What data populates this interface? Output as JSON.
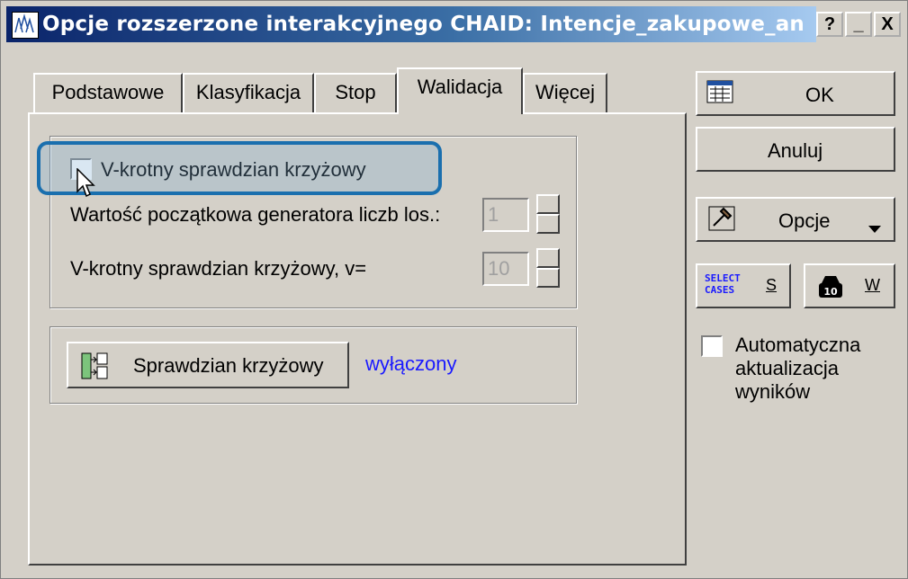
{
  "window": {
    "title": "Opcje rozszerzone interakcyjnego CHAID: Intencje_zakupowe_an",
    "help_label": "?",
    "minimize_label": "_",
    "close_label": "X"
  },
  "tabs": [
    {
      "label": "Podstawowe",
      "active": false
    },
    {
      "label": "Klasyfikacja",
      "active": false
    },
    {
      "label": "Stop",
      "active": false
    },
    {
      "label": "Walidacja",
      "active": true
    },
    {
      "label": "Więcej",
      "active": false
    }
  ],
  "validation": {
    "vfold_checkbox_label": "V-krotny sprawdzian krzyżowy",
    "vfold_checked": false,
    "seed_label": "Wartość początkowa generatora liczb los.:",
    "seed_value": "1",
    "v_label": "V-krotny sprawdzian krzyżowy, v=",
    "v_value": "10"
  },
  "crossval": {
    "button_label": "Sprawdzian krzyżowy",
    "status": "wyłączony",
    "status_color": "#1a1aff"
  },
  "side": {
    "ok_label": "OK",
    "cancel_label": "Anuluj",
    "options_label": "Opcje",
    "select_cases_line1": "SELECT",
    "select_cases_line2": "CASES",
    "select_cases_key": "S",
    "weight_key": "W",
    "auto_update_label_1": "Automatyczna",
    "auto_update_label_2": "aktualizacja",
    "auto_update_label_3": "wyników",
    "auto_update_checked": false
  }
}
